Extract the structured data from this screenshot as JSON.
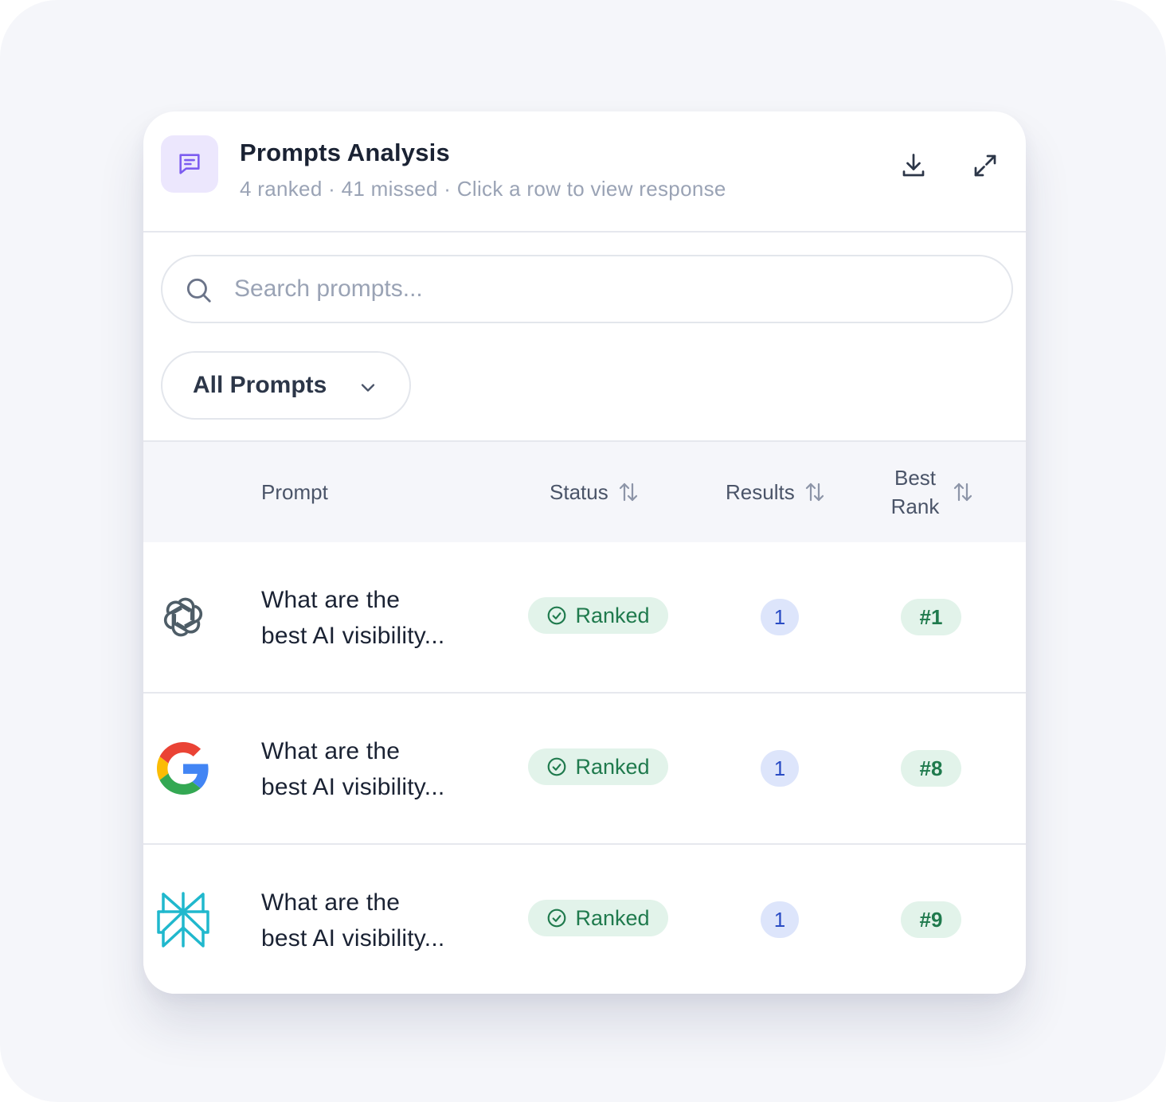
{
  "header": {
    "title": "Prompts Analysis",
    "subtitle": "4 ranked · 41 missed · Click a row to view response",
    "icon": "message-square-icon",
    "actions": [
      {
        "name": "download",
        "icon": "download-icon"
      },
      {
        "name": "expand",
        "icon": "expand-icon"
      }
    ]
  },
  "search": {
    "placeholder": "Search prompts...",
    "value": "",
    "icon": "search-icon"
  },
  "filter": {
    "label": "All Prompts",
    "icon": "chevron-down-icon"
  },
  "table": {
    "columns": {
      "prompt": "Prompt",
      "status": "Status",
      "results": "Results",
      "best_rank_line1": "Best",
      "best_rank_line2": "Rank"
    },
    "rows": [
      {
        "engine": "openai-icon",
        "prompt_line1": "What are the",
        "prompt_line2": "best AI visibility...",
        "status": "Ranked",
        "results": "1",
        "best_rank": "#1"
      },
      {
        "engine": "google-icon",
        "prompt_line1": "What are the",
        "prompt_line2": "best AI visibility...",
        "status": "Ranked",
        "results": "1",
        "best_rank": "#8"
      },
      {
        "engine": "perplexity-icon",
        "prompt_line1": "What are the",
        "prompt_line2": "best AI visibility...",
        "status": "Ranked",
        "results": "1",
        "best_rank": "#9"
      }
    ]
  },
  "colors": {
    "accent_purple": "#7c5cf0",
    "ranked_bg": "#e2f3ea",
    "ranked_text": "#1f7a4d",
    "results_bg": "#dde5fb",
    "results_text": "#2a4cc4"
  }
}
